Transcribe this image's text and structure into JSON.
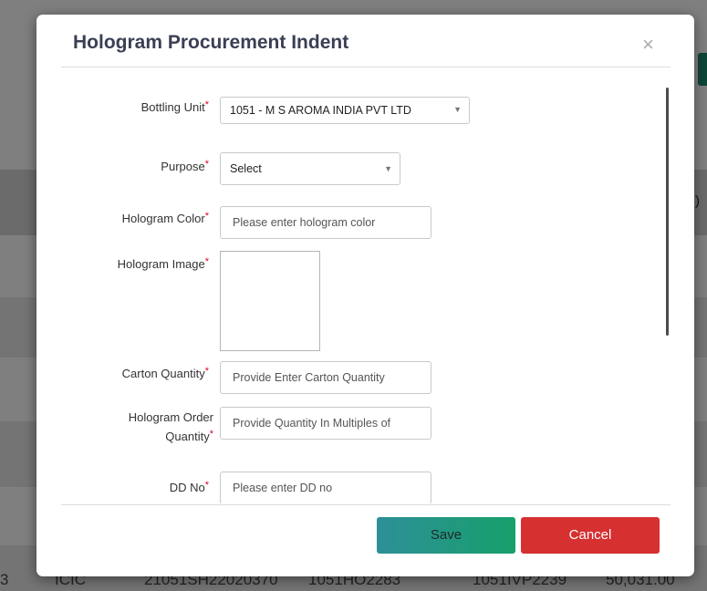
{
  "background": {
    "row_cells": [
      "3",
      "ICIC",
      "21051SH22020370",
      "1051HO2283",
      "1051IVP2239",
      "50,031.00"
    ],
    "header_fragment": ")"
  },
  "modal": {
    "title": "Hologram Procurement Indent",
    "close_glyph": "×",
    "required_mark": "*",
    "fields": {
      "bottling_unit": {
        "label": "Bottling Unit",
        "value": "1051 - M S AROMA INDIA PVT LTD"
      },
      "purpose": {
        "label": "Purpose",
        "value": "Select"
      },
      "hologram_color": {
        "label": "Hologram Color",
        "placeholder": "Please enter hologram color"
      },
      "hologram_image": {
        "label": "Hologram Image"
      },
      "carton_quantity": {
        "label": "Carton Quantity",
        "placeholder": "Provide Enter Carton Quantity"
      },
      "hologram_order_quantity": {
        "label_line1": "Hologram Order",
        "label_line2": "Quantity",
        "placeholder": "Provide Quantity In Multiples of"
      },
      "dd_no": {
        "label": "DD No",
        "placeholder": "Please enter DD no"
      }
    },
    "buttons": {
      "save": "Save",
      "cancel": "Cancel"
    }
  },
  "colors": {
    "title": "#3b3f54",
    "required": "#e2002a",
    "save_gradient_start": "#2d8f98",
    "save_gradient_end": "#17a06b",
    "cancel": "#d63031"
  }
}
